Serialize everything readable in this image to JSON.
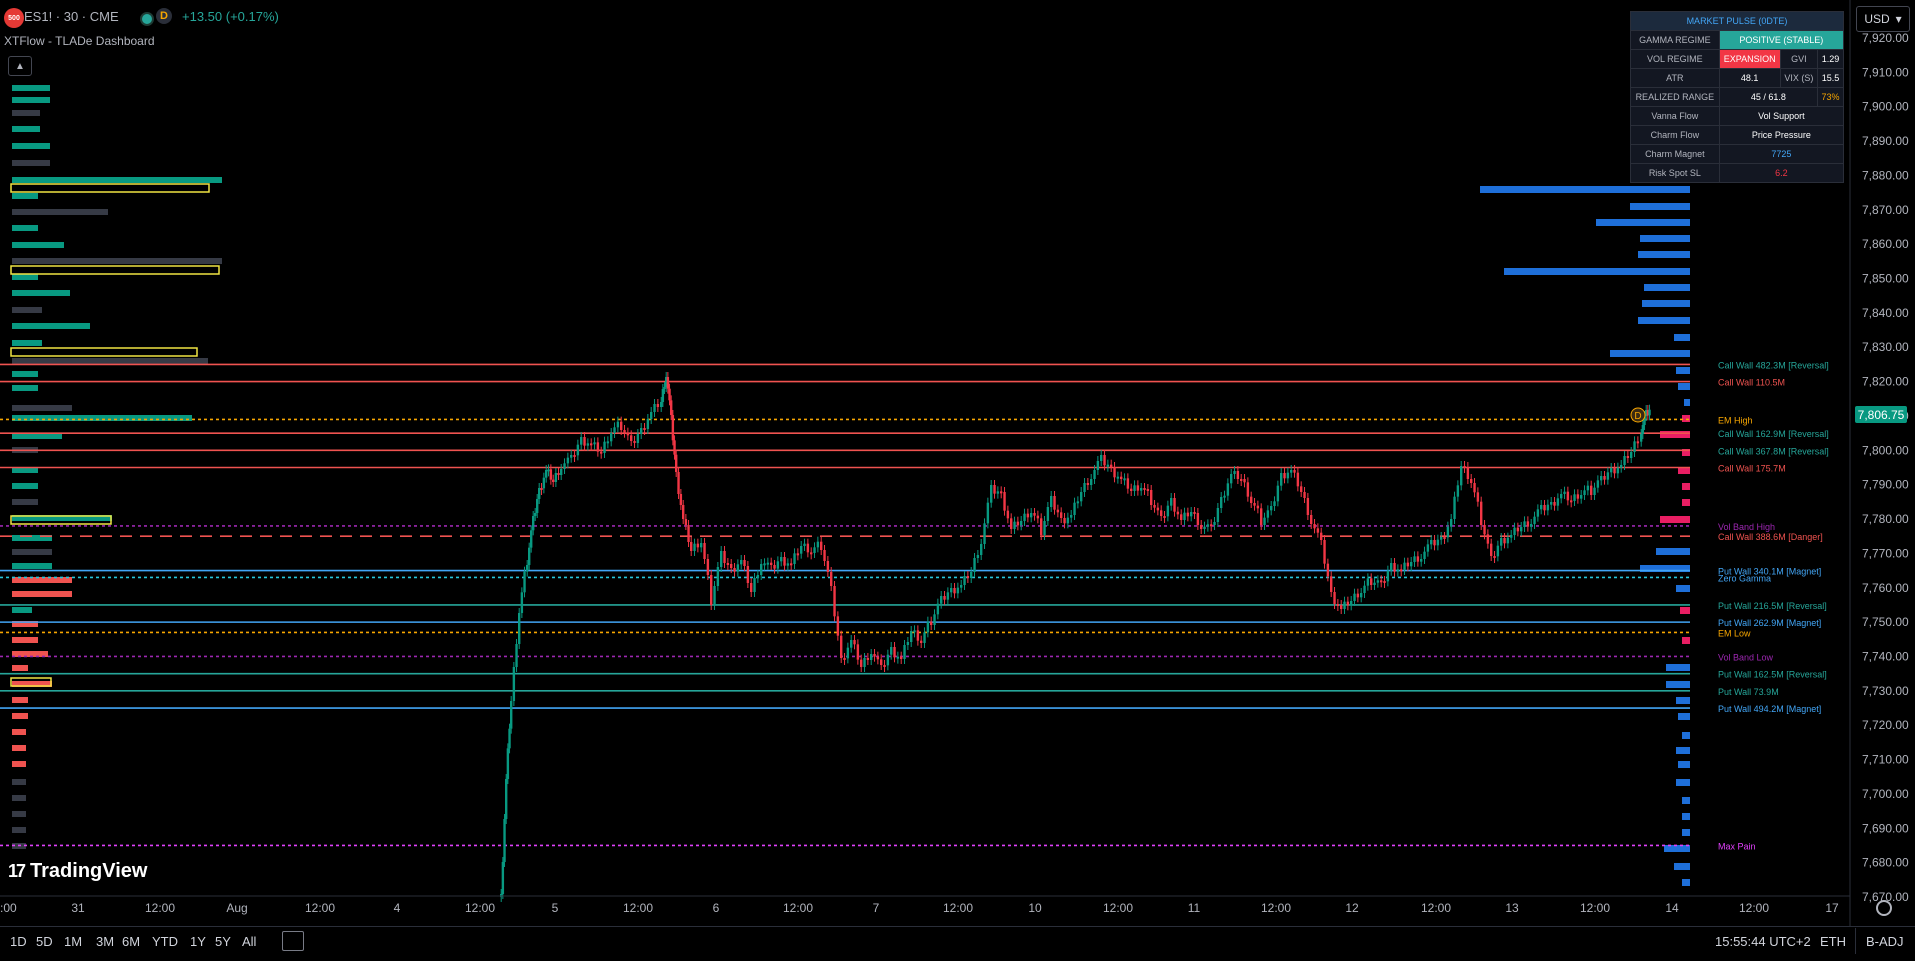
{
  "header": {
    "logo_text": "500",
    "symbol": "ES1! · 30 · CME",
    "d_badge": "D",
    "change": "+13.50 (+0.17%)",
    "indicator_name": "XTFlow - TLADe Dashboard",
    "collapse_icon": "chevron-up-icon"
  },
  "currency": {
    "label": "USD",
    "icon": "chevron-down-icon"
  },
  "market_pulse": {
    "title": "MARKET PULSE (0DTE)",
    "rows": [
      {
        "label": "GAMMA REGIME",
        "value": "POSITIVE (STABLE)",
        "value_color": "#26a69a"
      },
      {
        "label": "VOL REGIME",
        "value": "EXPANSION",
        "value_color": "#f23645",
        "sub_label": "GVI",
        "sub_value": "1.29"
      },
      {
        "label": "ATR",
        "value": "48.1",
        "sub_label": "VIX (S)",
        "sub_value": "15.5"
      },
      {
        "label": "REALIZED RANGE",
        "value": "45 / 61.8",
        "sub_value": "73%",
        "sub_color": "#f7a600"
      },
      {
        "label": "Vanna Flow",
        "value": "Vol Support"
      },
      {
        "label": "Charm Flow",
        "value": "Price Pressure"
      },
      {
        "label": "Charm Magnet",
        "value": "7725",
        "value_color": "#42a5f5"
      },
      {
        "label": "Risk Spot SL",
        "value": "6.2",
        "value_color": "#f23645"
      }
    ]
  },
  "price_axis": {
    "ticks": [
      "7,920.00",
      "7,910.00",
      "7,900.00",
      "7,890.00",
      "7,880.00",
      "7,870.00",
      "7,860.00",
      "7,850.00",
      "7,840.00",
      "7,830.00",
      "7,820.00",
      "7,810.00",
      "7,800.00",
      "7,790.00",
      "7,780.00",
      "7,770.00",
      "7,760.00",
      "7,750.00",
      "7,740.00",
      "7,730.00",
      "7,720.00",
      "7,710.00",
      "7,700.00",
      "7,690.00",
      "7,680.00",
      "7,670.00"
    ],
    "current_price": "7,806.75"
  },
  "time_axis": {
    "ticks": [
      ":00",
      "31",
      "12:00",
      "Aug",
      "12:00",
      "4",
      "12:00",
      "5",
      "12:00",
      "6",
      "12:00",
      "7",
      "12:00",
      "10",
      "12:00",
      "11",
      "12:00",
      "12",
      "12:00",
      "13",
      "12:00",
      "14",
      "12:00",
      "17"
    ]
  },
  "levels": [
    {
      "label": "Call Wall 482.3M [Reversal]",
      "price": 7825,
      "color": "#26a69a",
      "line_color": "#ef5350"
    },
    {
      "label": "Call Wall 110.5M",
      "price": 7820,
      "color": "#ef5350",
      "line_color": "#ef5350"
    },
    {
      "label": "EM High",
      "price": 7809,
      "color": "#f7a600",
      "line_color": "#f7a600",
      "dashed": true
    },
    {
      "label": "Call Wall 162.9M [Reversal]",
      "price": 7805,
      "color": "#26a69a",
      "line_color": "#ef5350"
    },
    {
      "label": "Call Wall 367.8M [Reversal]",
      "price": 7800,
      "color": "#26a69a",
      "line_color": "#ef5350"
    },
    {
      "label": "Call Wall 175.7M",
      "price": 7795,
      "color": "#ef5350",
      "line_color": "#ef5350"
    },
    {
      "label": "Vol Band High",
      "price": 7778,
      "color": "#9c27b0",
      "line_color": "#9c27b0",
      "dashed": true
    },
    {
      "label": "Call Wall 388.6M [Danger]",
      "price": 7775,
      "color": "#ef5350",
      "line_color": "#ef5350",
      "dashed": true
    },
    {
      "label": "Put Wall 340.1M [Magnet]",
      "price": 7765,
      "color": "#42a5f5",
      "line_color": "#42a5f5"
    },
    {
      "label": "Zero Gamma",
      "price": 7763,
      "color": "#42a5f5",
      "line_color": "#26c6da",
      "dashed": true
    },
    {
      "label": "Put Wall 216.5M [Reversal]",
      "price": 7755,
      "color": "#26a69a",
      "line_color": "#26a69a"
    },
    {
      "label": "Put Wall 262.9M [Magnet]",
      "price": 7750,
      "color": "#42a5f5",
      "line_color": "#42a5f5"
    },
    {
      "label": "EM Low",
      "price": 7747,
      "color": "#f7a600",
      "line_color": "#f7a600",
      "dashed": true
    },
    {
      "label": "Vol Band Low",
      "price": 7740,
      "color": "#9c27b0",
      "line_color": "#9c27b0",
      "dashed": true
    },
    {
      "label": "Put Wall 162.5M [Reversal]",
      "price": 7735,
      "color": "#26a69a",
      "line_color": "#26a69a"
    },
    {
      "label": "Put Wall 73.9M",
      "price": 7730,
      "color": "#26a69a",
      "line_color": "#26a69a"
    },
    {
      "label": "Put Wall 494.2M [Magnet]",
      "price": 7725,
      "color": "#42a5f5",
      "line_color": "#42a5f5"
    },
    {
      "label": "Max Pain",
      "price": 7685,
      "color": "#e040fb",
      "line_color": "#e040fb",
      "dashed": true
    }
  ],
  "timeframes": [
    "1D",
    "5D",
    "1M",
    "3M",
    "6M",
    "YTD",
    "1Y",
    "5Y",
    "All"
  ],
  "status_bar": {
    "clock": "15:55:44 UTC+2",
    "session": "ETH",
    "adj": "B-ADJ"
  },
  "branding": {
    "name": "TradingView"
  }
}
